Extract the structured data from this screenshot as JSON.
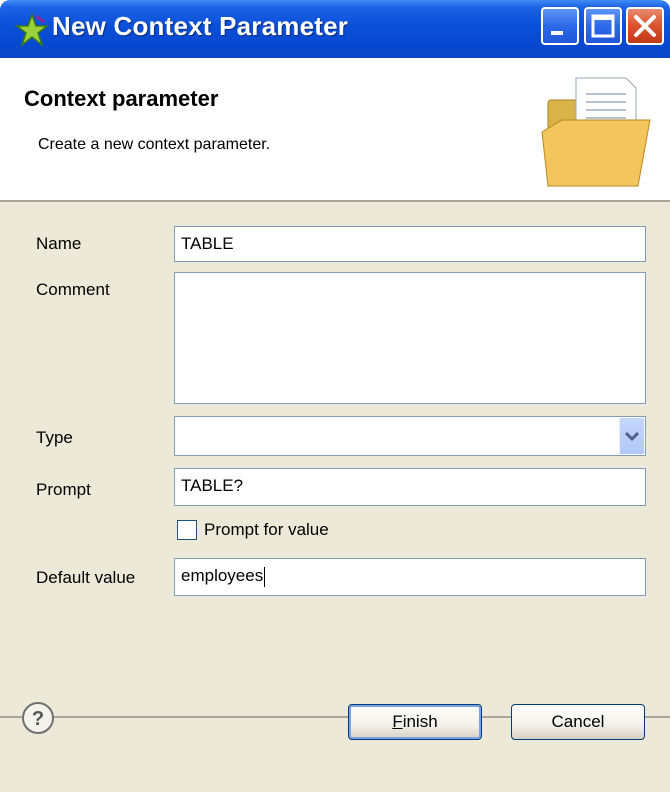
{
  "window": {
    "title": "New Context Parameter",
    "controls": [
      "minimize",
      "maximize",
      "close"
    ]
  },
  "header": {
    "title": "Context parameter",
    "description": "Create a new context parameter.",
    "icon": "folder-document-icon"
  },
  "form": {
    "name_label": "Name",
    "name_value": "TABLE",
    "comment_label": "Comment",
    "comment_value": "",
    "type_label": "Type",
    "type_value": "",
    "prompt_label": "Prompt",
    "prompt_value": "TABLE?",
    "prompt_checkbox_label": "Prompt for value",
    "prompt_checkbox_checked": false,
    "default_label": "Default value",
    "default_value": "employees"
  },
  "footer": {
    "finish_accel": "F",
    "finish_rest": "inish",
    "cancel_label": "Cancel"
  },
  "colors": {
    "titlebar": "#0a4fd8",
    "dialog_bg": "#ece9d8",
    "field_border": "#7f9db9"
  }
}
